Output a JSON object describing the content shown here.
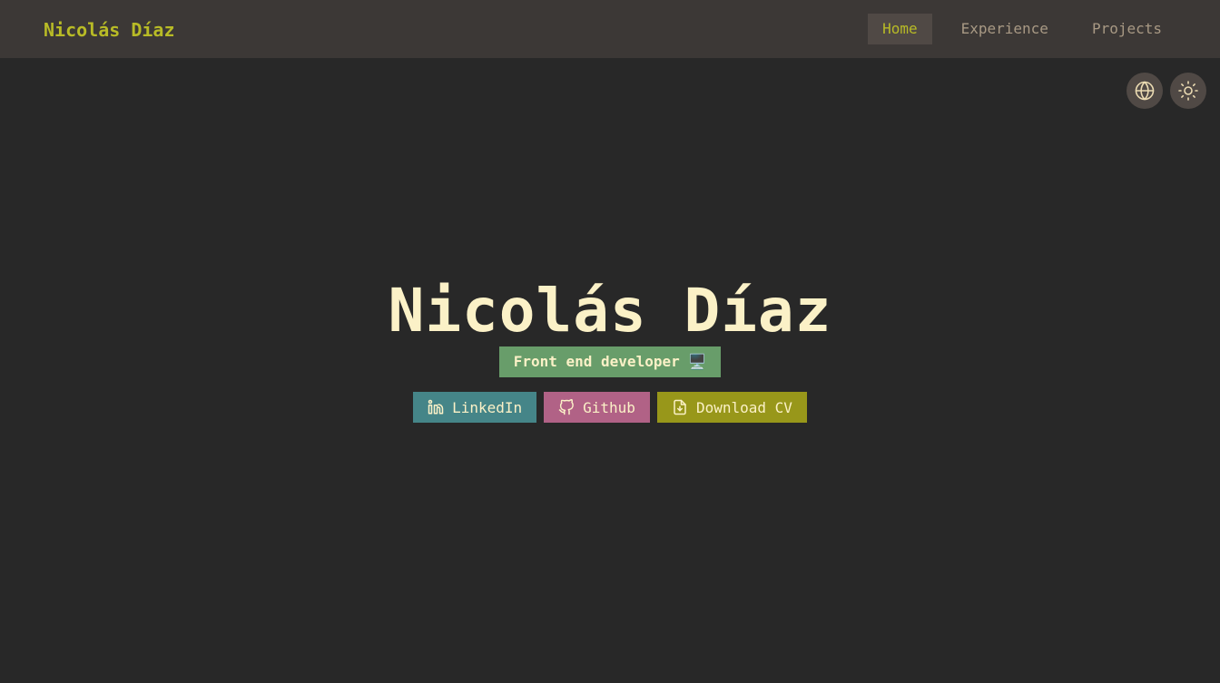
{
  "header": {
    "brand": "Nicolás Díaz",
    "nav": [
      {
        "label": "Home",
        "active": true
      },
      {
        "label": "Experience",
        "active": false
      },
      {
        "label": "Projects",
        "active": false
      }
    ]
  },
  "controls": {
    "language_icon": "globe-icon",
    "theme_icon": "sun-icon"
  },
  "hero": {
    "name": "Nicolás Díaz",
    "role": "Front end developer 🖥️",
    "links": [
      {
        "label": "LinkedIn",
        "icon": "linkedin-icon",
        "color": "#458588"
      },
      {
        "label": "Github",
        "icon": "github-icon",
        "color": "#b16286"
      },
      {
        "label": "Download CV",
        "icon": "file-download-icon",
        "color": "#98971a"
      }
    ]
  },
  "colors": {
    "background": "#282828",
    "navbar": "#3c3836",
    "accent": "#b8bb26",
    "text": "#fbf1c7",
    "muted": "#a89984",
    "role_badge": "#689d6a"
  }
}
